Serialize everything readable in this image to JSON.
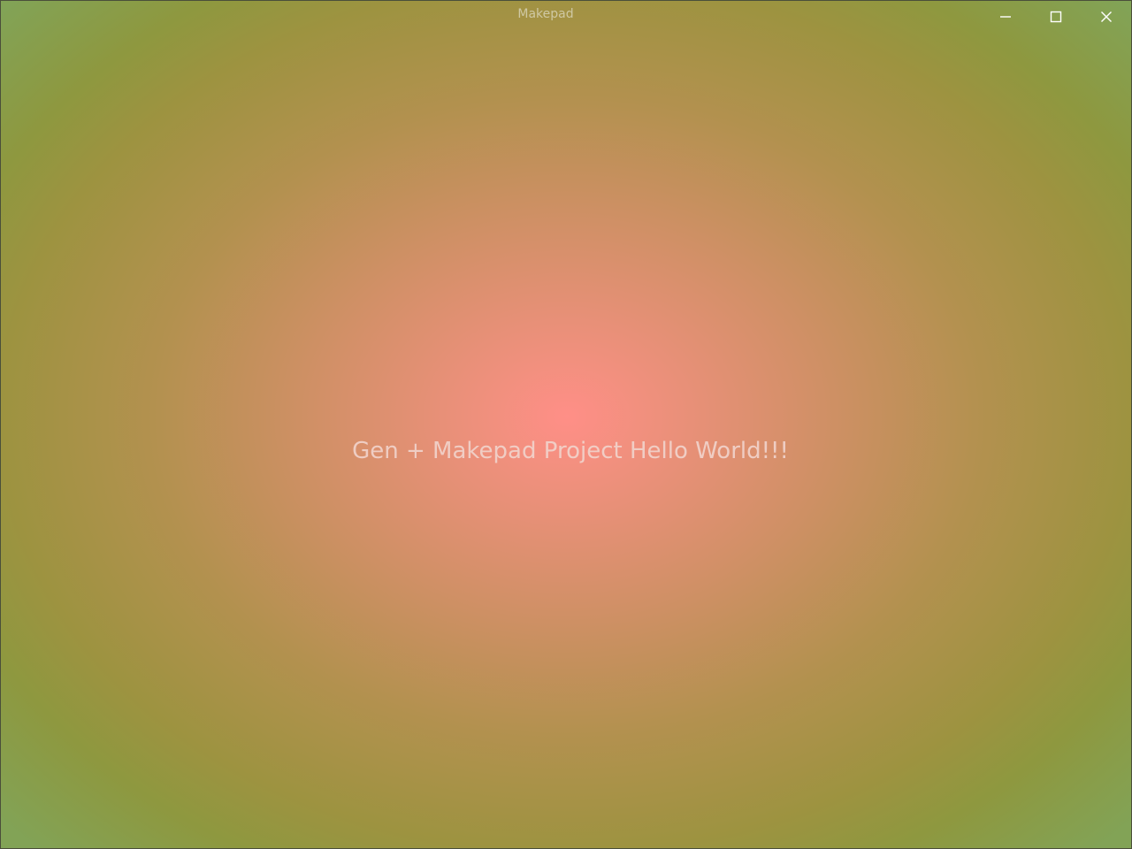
{
  "window": {
    "title": "Makepad",
    "controls": [
      {
        "name": "minimize",
        "icon": "minimize-icon"
      },
      {
        "name": "maximize",
        "icon": "maximize-icon"
      },
      {
        "name": "close",
        "icon": "close-icon"
      }
    ]
  },
  "content": {
    "message": "Gen + Makepad Project Hello World!!!"
  },
  "colors": {
    "center": "#ff8f87",
    "edge": "#9d9340",
    "text": "#f1d3cb"
  }
}
